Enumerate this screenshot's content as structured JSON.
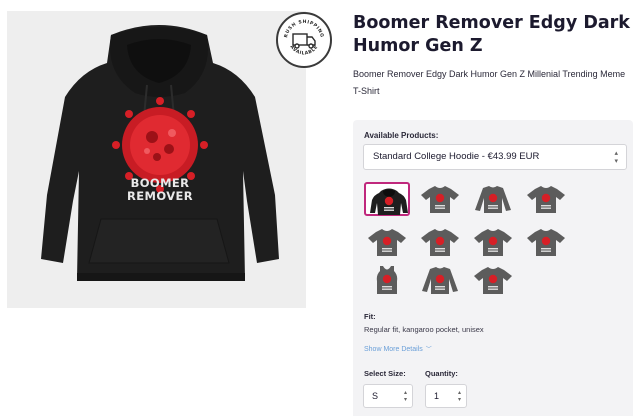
{
  "badge": {
    "line1": "RUSH SHIPPING",
    "line2": "AVAILABLE",
    "icon": "truck-icon"
  },
  "product": {
    "title": "Boomer Remover Edgy Dark Humor Gen Z",
    "description": "Boomer Remover Edgy Dark Humor Gen Z Millenial Trending Meme T-Shirt",
    "print_text_line1": "BOOMER",
    "print_text_line2": "REMOVER"
  },
  "options": {
    "available_label": "Available Products:",
    "selected_product": "Standard College Hoodie - €43.99 EUR",
    "thumbnails": [
      {
        "type": "hoodie",
        "selected": true
      },
      {
        "type": "tshirt"
      },
      {
        "type": "longsleeve"
      },
      {
        "type": "tshirt"
      },
      {
        "type": "tshirt"
      },
      {
        "type": "tshirt"
      },
      {
        "type": "tshirt"
      },
      {
        "type": "tshirt"
      },
      {
        "type": "tank"
      },
      {
        "type": "longsleeve"
      },
      {
        "type": "tshirt"
      }
    ],
    "fit_label": "Fit:",
    "fit_value": "Regular fit, kangaroo pocket, unisex",
    "show_more": "Show More Details",
    "size_label": "Select Size:",
    "size_value": "S",
    "quantity_label": "Quantity:",
    "quantity_value": "1"
  },
  "colors": {
    "accent": "#c0287d",
    "link": "#6a9fd8",
    "garment": "#5c5c5c",
    "hoodie": "#1e1e1e",
    "print_red": "#d61f26"
  }
}
